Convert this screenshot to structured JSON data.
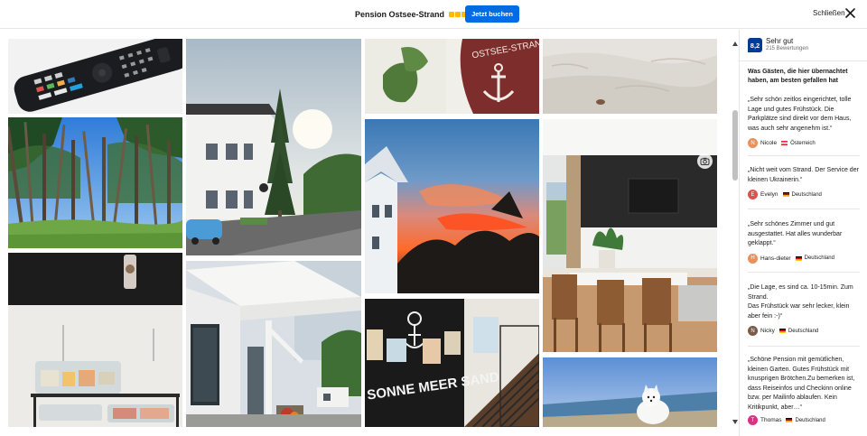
{
  "header": {
    "title": "Pension Ostsee-Strand",
    "star_count": 3,
    "star_color": "#febb02",
    "book_button": "Jetzt buchen",
    "close_label": "Schließen",
    "accent": "#006ce4"
  },
  "gallery": {
    "photos": [
      {
        "name": "photo-tv-remote"
      },
      {
        "name": "photo-forest"
      },
      {
        "name": "photo-breakfast-cart"
      },
      {
        "name": "photo-pension-exterior"
      },
      {
        "name": "photo-entrance-canopy"
      },
      {
        "name": "photo-ostsee-strand-sign",
        "sign_text": "OSTSEE-STRAND"
      },
      {
        "name": "photo-sunset"
      },
      {
        "name": "photo-staircase",
        "wall_text": "SONNE MEER SAND"
      },
      {
        "name": "photo-beach-sand"
      },
      {
        "name": "photo-dining-room"
      },
      {
        "name": "photo-dog-beach"
      }
    ]
  },
  "reviews": {
    "score": "8,2",
    "score_word": "Sehr gut",
    "review_count": "215 Bewertungen",
    "score_color": "#003b95",
    "heading": "Was Gästen, die hier übernachtet haben, am besten gefallen hat",
    "items": [
      {
        "text": "„Sehr schön zeitlos eingerichtet, tolle Lage und gutes Frühstück. Die Parkplätze sind direkt vor dem Haus, was auch sehr angenehm ist.“",
        "name": "Nicole",
        "initial": "N",
        "avatar_color": "#e8915c",
        "country": "Österreich",
        "flag": "at"
      },
      {
        "text": "„Nicht weit vom Strand. Der Service der kleinen Ukrainerin.“",
        "name": "Evelyn",
        "initial": "E",
        "avatar_color": "#d9534f",
        "country": "Deutschland",
        "flag": "de"
      },
      {
        "text": "„Sehr schönes Zimmer und gut ausgestattet. Hat alles wunderbar geklappt.“",
        "name": "Hans-dieter",
        "initial": "H",
        "avatar_color": "#e8915c",
        "country": "Deutschland",
        "flag": "de"
      },
      {
        "text": "„Die Lage, es sind ca. 10-15min. Zum Strand.\nDas Frühstück war sehr lecker, klein aber fein :-)“",
        "name": "Nicky",
        "initial": "N",
        "avatar_color": "#7a5a48",
        "country": "Deutschland",
        "flag": "de"
      },
      {
        "text": "„Schöne Pension mit gemütlichen, kleinen Garten. Gutes Frühstück mit knusprigen Brötchen.Zu bemerken ist, dass Reiseinfos und Checkinn online bzw. per Mailinfo ablaufen. Kein Kritikpunkt, aber…“",
        "name": "Thomas",
        "initial": "T",
        "avatar_color": "#d63384",
        "country": "Deutschland",
        "flag": "de"
      }
    ]
  }
}
